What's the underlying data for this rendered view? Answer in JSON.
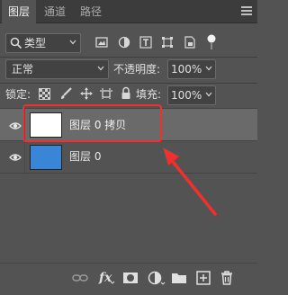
{
  "tabs": [
    {
      "label": "图层",
      "active": true
    },
    {
      "label": "通道",
      "active": false
    },
    {
      "label": "路径",
      "active": false
    }
  ],
  "filter": {
    "selected": "类型"
  },
  "blend": {
    "mode": "正常",
    "opacity_label": "不透明度:",
    "opacity_value": "100%"
  },
  "lock": {
    "label": "锁定:",
    "fill_label": "填充:",
    "fill_value": "100%"
  },
  "layers": [
    {
      "name": "图层 0 拷贝",
      "thumb_color": "#ffffff",
      "selected": true,
      "visible": true
    },
    {
      "name": "图层 0",
      "thumb_color": "#3a86d6",
      "selected": false,
      "visible": true
    }
  ],
  "colors": {
    "panel": "#535353",
    "selected_row": "#6a6a6a",
    "annotation": "#f0302e"
  },
  "icons": [
    "link-icon",
    "fx-icon",
    "mask-icon",
    "adjustment-icon",
    "folder-icon",
    "new-layer-icon",
    "trash-icon"
  ]
}
